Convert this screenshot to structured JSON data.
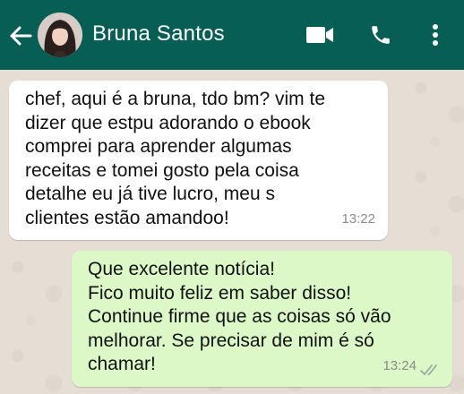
{
  "header": {
    "contact_name": "Bruna Santos",
    "back_icon": "arrow-left-icon",
    "video_icon": "video-call-icon",
    "phone_icon": "voice-call-icon",
    "menu_icon": "more-vert-icon",
    "color": "#075e54"
  },
  "messages": [
    {
      "direction": "incoming",
      "text": "chef, aqui é a bruna, tdo bm? vim te\ndizer que estpu adorando o ebook\ncomprei para aprender algumas\nreceitas e tomei gosto pela coisa\ndetalhe eu já tive lucro, meu s\nclientes estão amandoo!",
      "time": "13:22",
      "bubble_color": "#ffffff"
    },
    {
      "direction": "outgoing",
      "text": "Que excelente notícia!\nFico muito feliz em saber disso!\nContinue firme que as coisas só vão\nmelhorar. Se precisar de mim é só\nchamar!",
      "time": "13:24",
      "status": "read-double-check",
      "bubble_color": "#dcf8c6"
    }
  ]
}
